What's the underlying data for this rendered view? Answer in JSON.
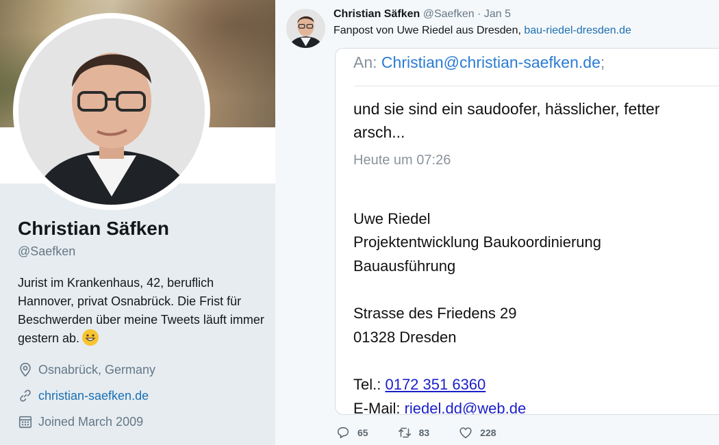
{
  "profile": {
    "name": "Christian Säfken",
    "handle": "@Saefken",
    "bio": "Jurist im Krankenhaus, 42, beruflich Hannover, privat Osnabrück. Die Frist für Beschwerden über meine Tweets läuft immer gestern ab.",
    "bio_emoji_icon": "grinning-face-icon",
    "location": "Osnabrück, Germany",
    "url": "christian-saefken.de",
    "joined": "Joined March 2009"
  },
  "tweet": {
    "author_name": "Christian Säfken",
    "author_handle": "@Saefken",
    "separator": "·",
    "date": "Jan 5",
    "text_prefix": "Fanpost von Uwe Riedel aus Dresden, ",
    "text_link": "bau-riedel-dresden.de",
    "stats": {
      "replies": "65",
      "retweets": "83",
      "likes": "228"
    }
  },
  "email": {
    "to_label": "An:",
    "to_address": "Christian@christian-saefken.de",
    "to_suffix": ";",
    "message": "und sie sind ein saudoofer, hässlicher, fetter arsch...",
    "time": "Heute um 07:26",
    "signature": {
      "name": "Uwe Riedel",
      "title_line1": "Projektentwicklung Baukoordinierung",
      "title_line2": "Bauausführung",
      "street": "Strasse des Friedens 29",
      "city": "01328 Dresden",
      "tel_label": "Tel.: ",
      "tel_number": "0172 351 6360",
      "mail_label": "E-Mail: ",
      "mail_address": "riedel.dd@web.de"
    }
  },
  "colors": {
    "link": "#1b6fb3",
    "muted": "#657786",
    "panel_bg": "#e6ecf0",
    "mail_link": "#1a1ec8"
  }
}
